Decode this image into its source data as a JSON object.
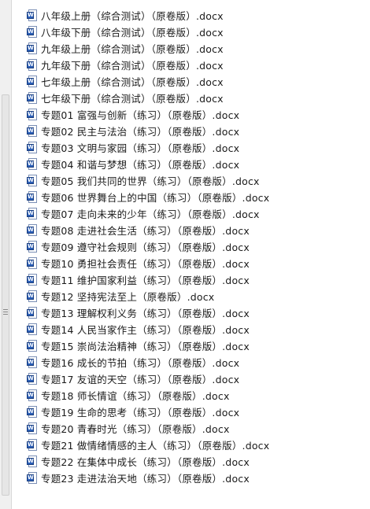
{
  "icon": "word-document-icon",
  "files": [
    "八年级上册（综合测试）（原卷版）.docx",
    "八年级下册（综合测试）（原卷版）.docx",
    "九年级上册（综合测试）（原卷版）.docx",
    "九年级下册（综合测试）（原卷版）.docx",
    "七年级上册（综合测试）（原卷版）.docx",
    "七年级下册（综合测试）（原卷版）.docx",
    "专题01 富强与创新（练习）（原卷版）.docx",
    "专题02 民主与法治（练习）（原卷版）.docx",
    "专题03 文明与家园（练习）（原卷版）.docx",
    "专题04 和谐与梦想（练习）（原卷版）.docx",
    "专题05 我们共同的世界（练习）（原卷版）.docx",
    "专题06 世界舞台上的中国（练习）（原卷版）.docx",
    "专题07 走向未来的少年（练习）（原卷版）.docx",
    "专题08 走进社会生活（练习）（原卷版）.docx",
    "专题09 遵守社会规则（练习）（原卷版）.docx",
    "专题10 勇担社会责任（练习）（原卷版）.docx",
    "专题11 维护国家利益（练习）（原卷版）.docx",
    "专题12 坚持宪法至上（原卷版）.docx",
    "专题13 理解权利义务（练习）（原卷版）.docx",
    "专题14 人民当家作主（练习）（原卷版）.docx",
    "专题15 崇尚法治精神（练习）（原卷版）.docx",
    "专题16 成长的节拍（练习）（原卷版）.docx",
    "专题17 友谊的天空（练习）（原卷版）.docx",
    "专题18 师长情谊（练习）（原卷版）.docx",
    "专题19 生命的思考（练习）（原卷版）.docx",
    "专题20 青春时光（练习）（原卷版）.docx",
    "专题21 做情绪情感的主人（练习）（原卷版）.docx",
    "专题22 在集体中成长（练习）（原卷版）.docx",
    "专题23 走进法治天地（练习）（原卷版）.docx"
  ]
}
